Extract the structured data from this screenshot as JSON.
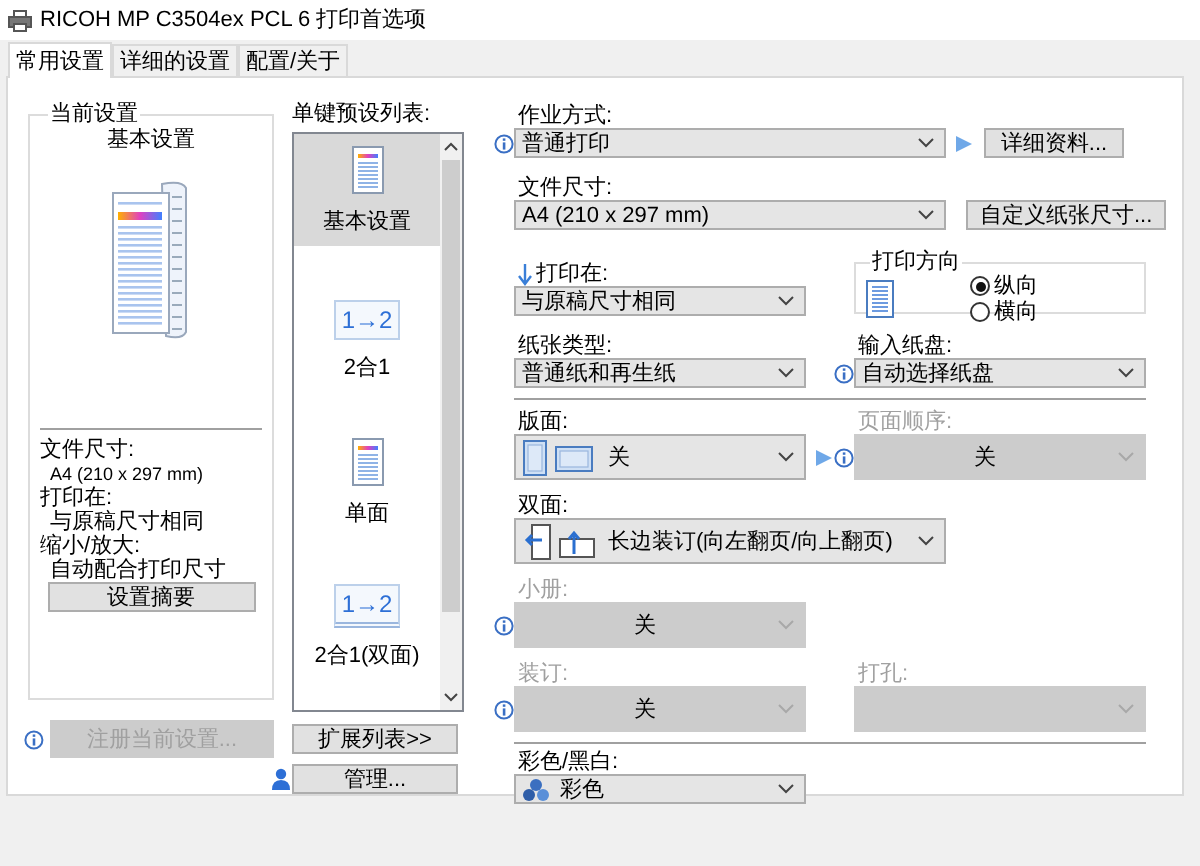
{
  "window": {
    "title": "RICOH MP C3504ex PCL 6 打印首选项"
  },
  "tabs": [
    {
      "label": "常用设置",
      "selected": true
    },
    {
      "label": "详细的设置",
      "selected": false
    },
    {
      "label": "配置/关于",
      "selected": false
    }
  ],
  "current_settings": {
    "title": "当前设置",
    "preset_name": "基本设置",
    "summary": [
      {
        "label": "文件尺寸:",
        "value": "A4 (210 x 297 mm)"
      },
      {
        "label": "打印在:",
        "value": "与原稿尺寸相同"
      },
      {
        "label": "缩小/放大:",
        "value": "自动配合打印尺寸"
      }
    ],
    "summary_button": "设置摘要",
    "register_button": {
      "label": "注册当前设置...",
      "disabled": true,
      "info": true
    }
  },
  "presets": {
    "label": "单键预设列表:",
    "items": [
      {
        "label": "基本设置",
        "selected": true,
        "kind": "page"
      },
      {
        "label": "2合1",
        "selected": false,
        "kind": "combine",
        "icon_text": "1→2"
      },
      {
        "label": "单面",
        "selected": false,
        "kind": "page"
      },
      {
        "label": "2合1(双面)",
        "selected": false,
        "kind": "combine-duplex",
        "icon_text": "1→2"
      }
    ],
    "expand_button": "扩展列表>>",
    "manage_button": "管理..."
  },
  "groups": [
    {
      "rows": [
        {
          "cells": [
            {
              "kind": "combo",
              "label": "作业方式:",
              "value": "普通打印",
              "disabled": false,
              "info": true,
              "arrow": true
            },
            {
              "kind": "button",
              "label": "详细资料..."
            }
          ]
        },
        {
          "cells": [
            {
              "kind": "combo",
              "label": "文件尺寸:",
              "value": "A4 (210 x 297 mm)",
              "disabled": false
            },
            {
              "kind": "button",
              "label": "自定义纸张尺寸..."
            }
          ]
        },
        {
          "cells": [
            {
              "kind": "target-combo",
              "label": "打印在:",
              "value": "与原稿尺寸相同",
              "disabled": false
            },
            {
              "kind": "orientation",
              "title": "打印方向",
              "options": [
                {
                  "label": "纵向",
                  "selected": true
                },
                {
                  "label": "横向",
                  "selected": false
                }
              ]
            }
          ]
        },
        {
          "cells": [
            {
              "kind": "combo",
              "label": "纸张类型:",
              "value": "普通纸和再生纸",
              "disabled": false
            },
            {
              "kind": "combo",
              "label": "输入纸盘:",
              "value": "自动选择纸盘",
              "disabled": false,
              "info": true
            }
          ]
        }
      ]
    },
    {
      "rows": [
        {
          "cells": [
            {
              "kind": "layout-combo",
              "label": "版面:",
              "value": "关",
              "disabled": false,
              "arrow": true
            },
            {
              "kind": "combo",
              "label": "页面顺序:",
              "value": "关",
              "disabled": true,
              "info": true
            }
          ]
        },
        {
          "cells": [
            {
              "kind": "duplex-combo",
              "label": "双面:",
              "value": "长边装订(向左翻页/向上翻页)",
              "disabled": false
            }
          ]
        },
        {
          "cells": [
            {
              "kind": "combo",
              "label": "小册:",
              "value": "关",
              "disabled": true,
              "info": true
            }
          ]
        },
        {
          "cells": [
            {
              "kind": "combo",
              "label": "装订:",
              "value": "关",
              "disabled": true,
              "info": true
            },
            {
              "kind": "combo",
              "label": "打孔:",
              "disabled": true
            }
          ]
        }
      ]
    },
    {
      "rows": [
        {
          "cells": [
            {
              "kind": "color-combo",
              "label": "彩色/黑白:",
              "value": "彩色",
              "disabled": false
            }
          ]
        }
      ]
    }
  ]
}
